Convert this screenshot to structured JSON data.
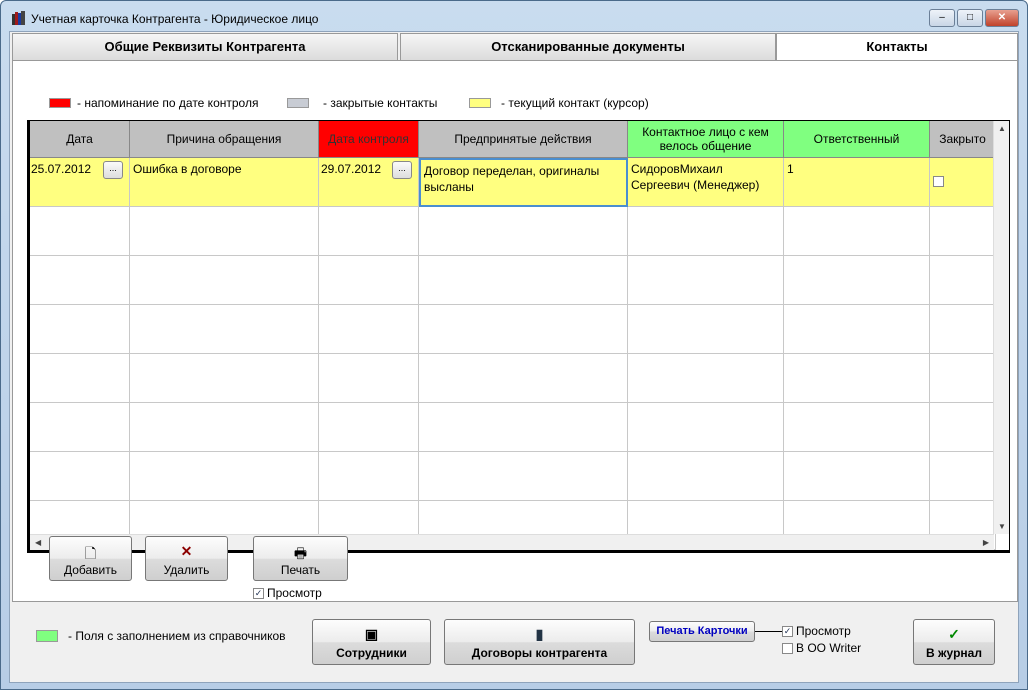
{
  "window": {
    "title": "Учетная карточка Контрагента - Юридическое лицо",
    "min": "–",
    "max": "□",
    "close": "✕"
  },
  "tabs": [
    {
      "label": "Общие Реквизиты Контрагента"
    },
    {
      "label": "Отсканированные документы"
    },
    {
      "label": "Контакты"
    }
  ],
  "legend": [
    {
      "label": "- напоминание по дате контроля",
      "color": "#ff0000"
    },
    {
      "label": "- закрытые контакты",
      "color": "#c8ccd4"
    },
    {
      "label": "- текущий контакт (курсор)",
      "color": "#ffff80"
    }
  ],
  "grid": {
    "columns": [
      "Дата",
      "Причина обращения",
      "Дата контроля",
      "Предпринятые действия",
      "Контактное лицо с кем велось общение",
      "Ответственный",
      "Закрыто"
    ],
    "rows": [
      {
        "date": "25.07.2012",
        "reason": "Ошибка в договоре",
        "control_date": "29.07.2012",
        "actions": "Договор переделан, оригиналы высланы",
        "contact": "СидоровМихаил Сергеевич (Менеджер)",
        "responsible": "1",
        "closed": false
      }
    ],
    "dots": "..."
  },
  "buttons": {
    "add": "Добавить",
    "delete": "Удалить",
    "print": "Печать",
    "preview": "Просмотр",
    "preview_checked": true
  },
  "footer": {
    "legend": "- Поля с заполнением из справочников",
    "employees": "Сотрудники",
    "contracts": "Договоры контрагента",
    "print_card": "Печать Карточки",
    "preview": "Просмотр",
    "preview_checked": true,
    "oo_writer": "В OO Writer",
    "oo_checked": false,
    "journal": "В журнал"
  }
}
